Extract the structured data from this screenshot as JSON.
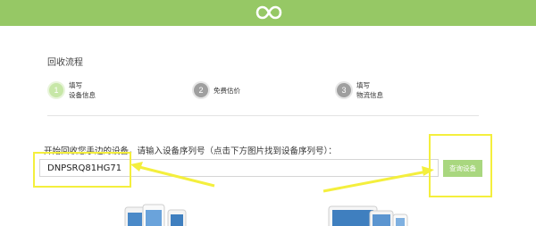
{
  "header": {
    "logo_icon": "infinity-logo-icon",
    "bar_color": "#96c865"
  },
  "process": {
    "title": "回收流程",
    "steps": [
      {
        "number": "1",
        "line1": "填写",
        "line2": "设备信息",
        "state": "active"
      },
      {
        "number": "2",
        "line1": "免费估价",
        "line2": "",
        "state": "inactive"
      },
      {
        "number": "3",
        "line1": "填写",
        "line2": "物流信息",
        "state": "inactive"
      }
    ]
  },
  "lookup": {
    "prompt": "开始回收您手边的设备，请输入设备序列号（点击下方图片找到设备序列号）：",
    "serial_value": "DNPSRQ81HG71",
    "button_label": "查询设备"
  },
  "images": {
    "left": "iphone-devices-image",
    "right": "ipad-devices-image"
  },
  "annotations": {
    "highlight_color": "#f4ef3d"
  }
}
